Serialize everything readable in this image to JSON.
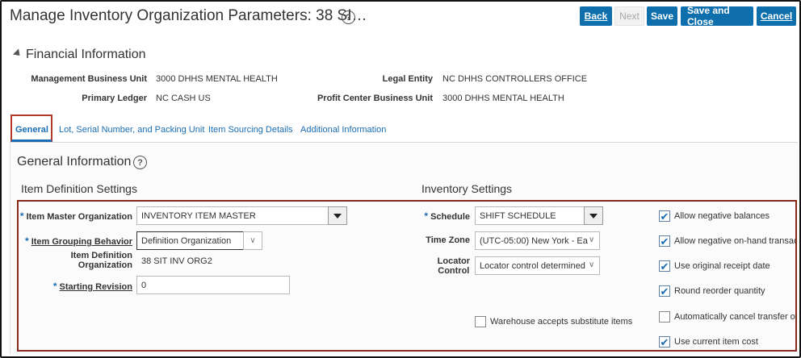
{
  "header": {
    "title": "Manage Inventory Organization Parameters: 38 SI…",
    "buttons": {
      "back": "Back",
      "next": "Next",
      "save": "Save",
      "save_close": "Save and Close",
      "cancel": "Cancel"
    }
  },
  "financial": {
    "title": "Financial Information",
    "management_bu_label": "Management Business Unit",
    "management_bu_value": "3000 DHHS MENTAL HEALTH",
    "legal_entity_label": "Legal Entity",
    "legal_entity_value": "NC DHHS CONTROLLERS OFFICE",
    "primary_ledger_label": "Primary Ledger",
    "primary_ledger_value": "NC CASH US",
    "profit_center_label": "Profit Center Business Unit",
    "profit_center_value": "3000 DHHS MENTAL HEALTH"
  },
  "tabs": [
    "General",
    "Lot, Serial Number, and Packing Unit",
    "Item Sourcing Details",
    "Additional Information"
  ],
  "general": {
    "title": "General Information",
    "item_def": {
      "title": "Item Definition Settings",
      "item_master_label": "Item Master Organization",
      "item_master_value": "INVENTORY ITEM MASTER",
      "grouping_label": "Item Grouping Behavior",
      "grouping_value": "Definition Organization",
      "def_org_label_1": "Item Definition",
      "def_org_label_2": "Organization",
      "def_org_value": "38 SIT INV ORG2",
      "revision_label": "Starting Revision",
      "revision_value": "0"
    },
    "inventory": {
      "title": "Inventory Settings",
      "schedule_label": "Schedule",
      "schedule_value": "SHIFT SCHEDULE",
      "timezone_label": "Time Zone",
      "timezone_value": "(UTC-05:00) New York - Ea",
      "locator_label_1": "Locator",
      "locator_label_2": "Control",
      "locator_value": "Locator control determined",
      "warehouse_sub_label": "Warehouse accepts substitute items"
    },
    "checkboxes": [
      {
        "label": "Allow negative balances",
        "checked": true
      },
      {
        "label": "Allow negative on-hand transactio",
        "checked": true
      },
      {
        "label": "Use original receipt date",
        "checked": true
      },
      {
        "label": "Round reorder quantity",
        "checked": true
      },
      {
        "label": "Automatically cancel transfer orde",
        "checked": false
      },
      {
        "label": "Use current item cost",
        "checked": true
      }
    ]
  },
  "icons": {
    "help": "help-circle-icon",
    "collapse": "collapse-triangle-icon",
    "check": "check-icon"
  },
  "colors": {
    "primary": "#0f6fad",
    "link": "#1a6db3",
    "highlight": "#8b2a1c"
  }
}
